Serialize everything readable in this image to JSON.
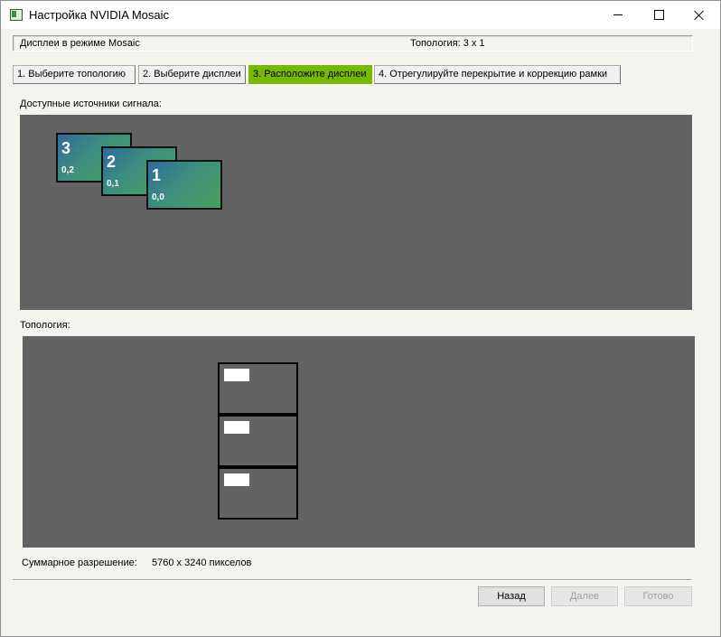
{
  "window": {
    "title": "Настройка NVIDIA Mosaic"
  },
  "status": {
    "mode_text": "Дисплеи в режиме Mosaic",
    "topology_text": "Топология: 3 x 1"
  },
  "steps": [
    {
      "label": "1. Выберите топологию",
      "active": false
    },
    {
      "label": "2. Выберите дисплеи",
      "active": false
    },
    {
      "label": "3. Расположите дисплеи",
      "active": true
    },
    {
      "label": "4. Отрегулируйте перекрытие и коррекцию рамки",
      "active": false
    }
  ],
  "sources": {
    "label": "Доступные источники сигнала:",
    "displays": [
      {
        "number": "3",
        "coord": "0,2"
      },
      {
        "number": "2",
        "coord": "0,1"
      },
      {
        "number": "1",
        "coord": "0,0"
      }
    ]
  },
  "topology": {
    "label": "Топология:",
    "rows": 3,
    "columns": 1
  },
  "resolution": {
    "label": "Суммарное разрешение:",
    "value": "5760 x 3240 пикселов"
  },
  "buttons": {
    "back": "Назад",
    "next": "Далее",
    "done": "Готово"
  },
  "colors": {
    "accent": "#76b900",
    "panel": "#636363"
  },
  "icons": {
    "app": "nvidia-app-icon",
    "minimize": "minimize-icon",
    "maximize": "maximize-icon",
    "close": "close-icon"
  }
}
